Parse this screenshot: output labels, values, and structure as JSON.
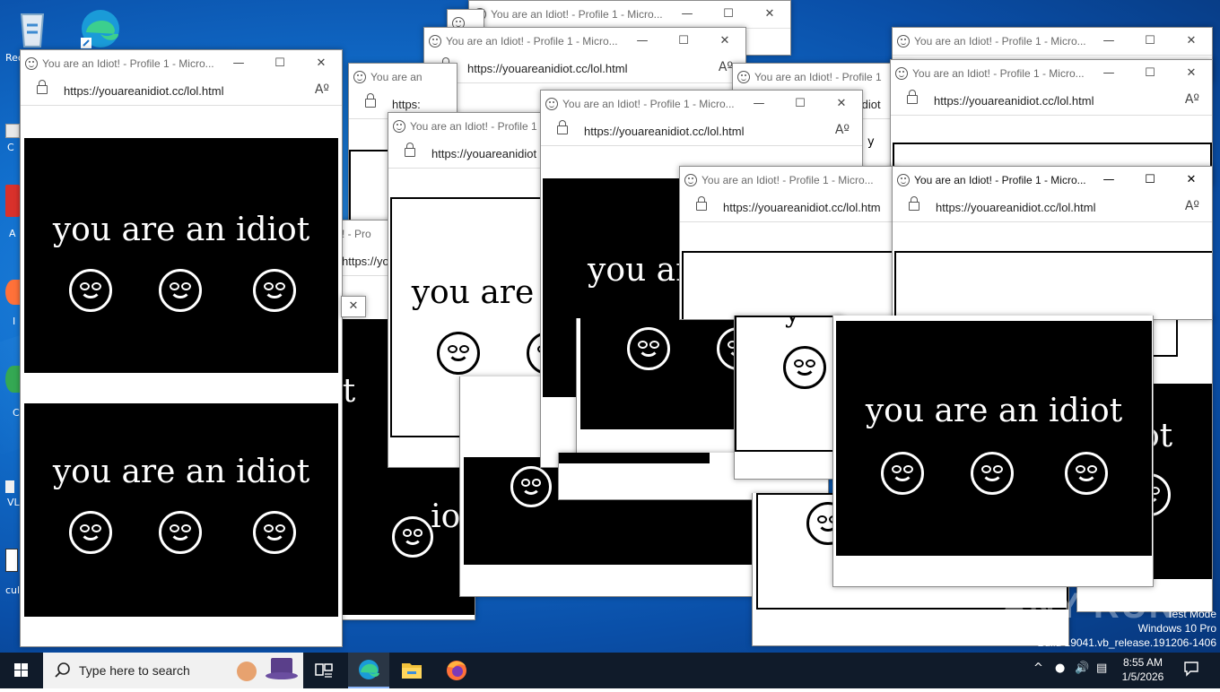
{
  "window": {
    "title": "You are an Idiot! - Profile 1 - Micro...",
    "title_short": "You are an Idiot! - Profile 1",
    "title_tiny": "You are an",
    "url": "https://youareanidiot.cc/lol.html",
    "url_short": "https://youareanidiot.cc/lol.htm",
    "url_tiny": "https://youareanidiot",
    "url_part": "https://youare",
    "read_aloud_glyph": "Aº",
    "minimize_glyph": "—",
    "maximize_glyph": "☐",
    "close_glyph": "✕"
  },
  "page": {
    "message": "you are an idiot",
    "fragment_1": "you are",
    "fragment_2": "you ar",
    "fragment_3": "iot",
    "fragment_4": "ot",
    "fragment_5": "t",
    "fragment_6": "y"
  },
  "desktop": {
    "icons": [
      {
        "label": "Rec",
        "icon": "recycle-bin-icon"
      },
      {
        "label": "",
        "icon": "edge-shortcut-icon"
      },
      {
        "label": "C",
        "icon": "shortcut-icon"
      },
      {
        "label": "A",
        "icon": "adobe-shortcut-icon"
      },
      {
        "label": "I",
        "icon": "firefox-shortcut-icon"
      },
      {
        "label": "C",
        "icon": "chrome-shortcut-icon"
      },
      {
        "label": "VL",
        "icon": "vlc-shortcut-icon"
      },
      {
        "label": "cul",
        "icon": "file-shortcut-icon"
      }
    ],
    "watermark_brand": "ANY RUN",
    "test_mode": "Test Mode",
    "os_edition": "Windows 10 Pro",
    "build": "Build 19041.vb_release.191206-1406"
  },
  "taskbar": {
    "search_placeholder": "Type here to search",
    "apps": [
      "start-icon",
      "task-view-icon",
      "edge-icon",
      "file-explorer-icon",
      "firefox-icon"
    ],
    "clock_time": "8:55 AM",
    "clock_date": "1/5/2026"
  },
  "colors": {
    "desktop_blue": "#1271cf",
    "taskbar": "#101b2a",
    "panel_black": "#000000",
    "panel_white": "#ffffff"
  }
}
